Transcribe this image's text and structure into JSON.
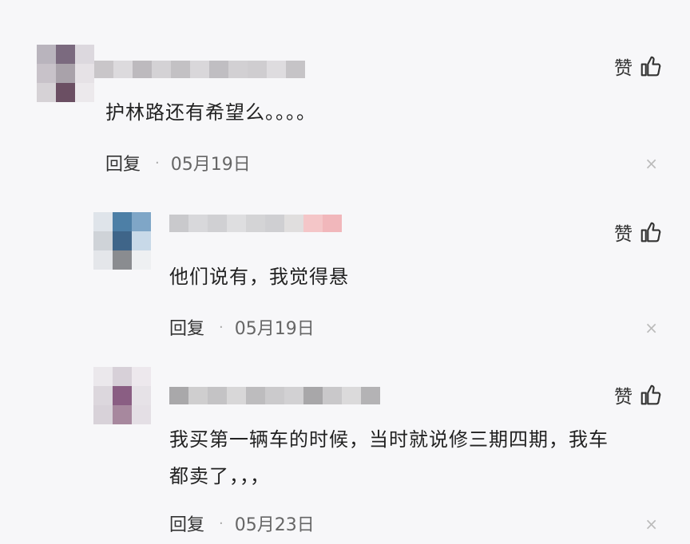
{
  "comments": [
    {
      "text": "护林路还有希望么。。。。",
      "like_label": "赞",
      "reply_label": "回复",
      "date": "05月19日",
      "dismiss": "×",
      "avatar_colors": [
        "#b9b4bd",
        "#7b6a7f",
        "#dcd8de",
        "#c8c2c9",
        "#a9a2aa",
        "#e6e2e6",
        "#d6d2d6",
        "#6b4f63",
        "#ece9ec"
      ],
      "name_colors": [
        "#c9c6c9",
        "#dcdadd",
        "#bdbabe",
        "#d4d2d5",
        "#c3c1c4",
        "#d9d7da",
        "#c0bec2",
        "#d2d0d3",
        "#cfcdd0",
        "#dedcdf",
        "#c6c4c7"
      ]
    },
    {
      "text": "他们说有，我觉得悬",
      "like_label": "赞",
      "reply_label": "回复",
      "date": "05月19日",
      "dismiss": "×",
      "avatar_colors": [
        "#dfe4ea",
        "#4d7fa6",
        "#7fa6c7",
        "#cfd3d8",
        "#3f6589",
        "#c8d9e8",
        "#e4e6ea",
        "#8a8c90",
        "#eef0f2"
      ],
      "name_colors": [
        "#c9c9cc",
        "#d8d8db",
        "#d0d0d3",
        "#dedee0",
        "#d4d4d6",
        "#cfcfd2",
        "#e0dede",
        "#f4c6c8",
        "#f1b7bb"
      ]
    },
    {
      "text_lines": [
        "我买第一辆车的时候，当时就说修三期四期，我车",
        "都卖了，，，"
      ],
      "like_label": "赞",
      "reply_label": "回复",
      "date": "05月23日",
      "dismiss": "×",
      "avatar_colors": [
        "#ebe8ec",
        "#d7d0d8",
        "#ede8ed",
        "#dcd7dd",
        "#8a5e83",
        "#e6e2e7",
        "#d8d2d9",
        "#a7889e",
        "#e4dfe5"
      ],
      "name_colors": [
        "#a9a8aa",
        "#cfcecf",
        "#c4c3c5",
        "#d8d7d8",
        "#bdbcbe",
        "#cbcacc",
        "#d2d1d3",
        "#a8a7a9",
        "#c9c8ca",
        "#dbdadb",
        "#b4b3b5"
      ]
    }
  ]
}
